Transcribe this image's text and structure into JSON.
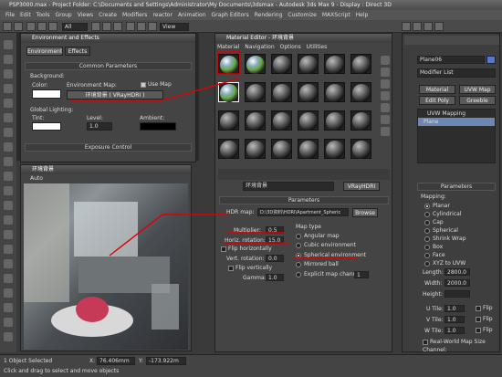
{
  "app": {
    "title": "PSP3000.max   - Project Folder: C:\\Documents and Settings\\Administrator\\My Documents\\3dsmax   - Autodesk 3ds Max 9   - Display : Direct 3D"
  },
  "menu": [
    "File",
    "Edit",
    "Tools",
    "Group",
    "Views",
    "Create",
    "Modifiers",
    "reactor",
    "Animation",
    "Graph Editors",
    "Rendering",
    "Customize",
    "MAXScript",
    "Help"
  ],
  "toolbar": {
    "selection_filter": "All",
    "view_dropdown": "View"
  },
  "env_panel": {
    "title": "Environment and Effects",
    "tabs": [
      "Environment",
      "Effects"
    ],
    "rollup_common": "Common Parameters",
    "background_label": "Background:",
    "color_label": "Color:",
    "env_map_label": "Environment Map:",
    "use_map_label": "Use Map",
    "env_map_button": "环境背景 ( VRayHDRI )",
    "global_lighting_label": "Global Lighting:",
    "tint_label": "Tint:",
    "level_label": "Level:",
    "level_value": "1.0",
    "ambient_label": "Ambient:",
    "rollup_exposure": "Exposure Control"
  },
  "preview": {
    "title": "环境背景",
    "auto_label": "Auto"
  },
  "material_editor": {
    "title": "Material Editor - 环境背景",
    "menu": [
      "Material",
      "Navigation",
      "Options",
      "Utilities"
    ],
    "map_name": "环境背景",
    "map_type": "VRayHDRI",
    "rollup_params": "Parameters",
    "hdr_map_label": "HDR map:",
    "hdr_map_path": "D:\\3D资料\\HDRI\\Apartment_Spheric",
    "browse_label": "Browse",
    "multiplier_label": "Multiplier:",
    "multiplier_value": "0.5",
    "horiz_rotation_label": "Horiz. rotation:",
    "horiz_rotation_value": "15.0",
    "flip_h_label": "Flip horizontally",
    "vert_rotation_label": "Vert. rotation:",
    "vert_rotation_value": "0.0",
    "flip_v_label": "Flip vertically",
    "gamma_label": "Gamma:",
    "gamma_value": "1.0",
    "map_type_label": "Map type",
    "map_types": [
      "Angular map",
      "Cubic environment",
      "Spherical environment",
      "Mirrored ball",
      "Explicit map channel"
    ],
    "selected_map_type": 2,
    "explicit_channel_value": "1"
  },
  "command_panel": {
    "object_name": "Plane06",
    "modifier_list_label": "Modifier List",
    "buttons": [
      "Material",
      "UVW Map",
      "Edit Poly",
      "Greeble"
    ],
    "stack": [
      "UVW Mapping",
      "Plane"
    ],
    "rollup_params": "Parameters",
    "mapping_label": "Mapping:",
    "mapping_types": [
      "Planar",
      "Cylindrical",
      "Cap",
      "Spherical",
      "Shrink Wrap",
      "Box",
      "Face",
      "XYZ to UVW"
    ],
    "length_label": "Length:",
    "length_value": "2800.0",
    "width_label": "Width:",
    "width_value": "2000.0",
    "height_label": "Height:",
    "utile_label": "U Tile:",
    "utile_value": "1.0",
    "vtile_label": "V Tile:",
    "vtile_value": "1.0",
    "wtile_label": "W Tile:",
    "wtile_value": "1.0",
    "flip_label": "Flip",
    "real_world_label": "Real-World Map Size",
    "channel_label": "Channel:"
  },
  "status": {
    "selected": "1 Object Selected",
    "hint": "Click and drag to select and move objects",
    "x_label": "X:",
    "x_value": "76.406mm",
    "y_label": "Y:",
    "y_value": "-173.922m"
  }
}
